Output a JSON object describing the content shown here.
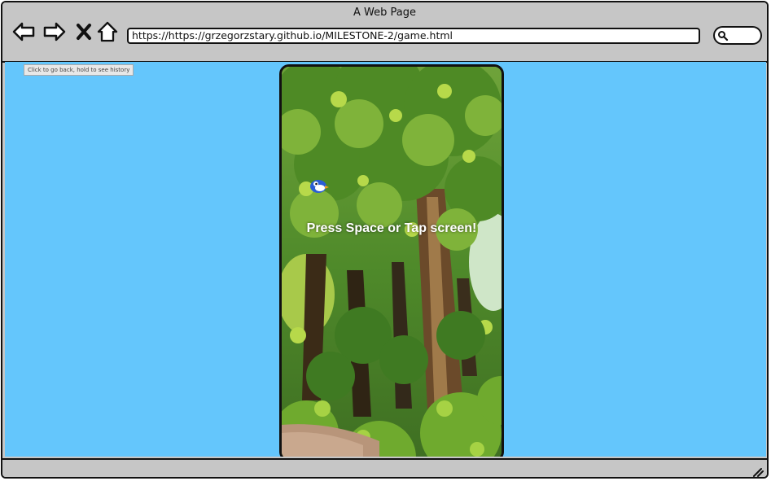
{
  "browser": {
    "window_title": "A Web Page",
    "url": "https://https://grzegorzstary.github.io/MILESTONE-2/game.html",
    "back_tooltip": "Click to go back, hold to see history",
    "nav": {
      "back": "back-arrow-icon",
      "forward": "forward-arrow-icon",
      "stop": "close-x-icon",
      "home": "home-icon"
    },
    "search_icon": "search-icon"
  },
  "game": {
    "prompt_text": "Press Space or Tap screen!",
    "player": "bird-sprite",
    "background": "forest-scene",
    "colors": {
      "viewport_bg": "#64c6fc",
      "foliage": "#5f9d2c",
      "prompt": "#ffffff"
    }
  }
}
